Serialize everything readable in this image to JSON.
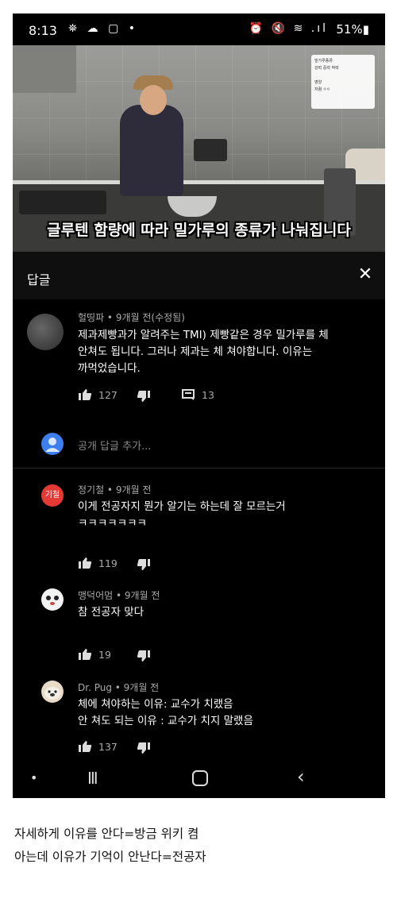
{
  "status_bar": {
    "time": "8:13",
    "left_icons": "⛯ ☁ ▢ •",
    "right_icons": "⏰ 🔇 ≋ .ıl",
    "battery": "51%"
  },
  "video": {
    "caption": "글루텐 함량에 따라 밀가루의 종류가 나눠집니다",
    "progress": 0.23,
    "overlay_lines": [
      "밀가루종류",
      "강력 중력 박력",
      "",
      "영양",
      "저렴 ㅇㅇ"
    ]
  },
  "panel": {
    "title": "답글",
    "close_label": "✕"
  },
  "main_comment": {
    "author": "헐띵파 • 9개월 전(수정됨)",
    "lines": [
      "제과제빵과가 알려주는 TMI) 제빵같은 경우 밀가루를 체",
      "안쳐도 됩니다. 그러나 제과는 체 쳐야합니다. 이유는",
      "까먹었습니다."
    ],
    "likes": "127",
    "replies": "13"
  },
  "add_reply": {
    "placeholder": "공개 답글 추가..."
  },
  "replies": [
    {
      "avatar_text": "기철",
      "author": "정기철 • 9개월 전",
      "lines": [
        "이게 전공자지 뭔가 알기는 하는데 잘 모르는거",
        "ㅋㅋㅋㅋㅋㅋㅋ"
      ],
      "likes": "119"
    },
    {
      "avatar_text": "",
      "author": "맹덕어멈 • 9개월 전",
      "lines": [
        "참 전공자 맞다"
      ],
      "likes": "19"
    },
    {
      "avatar_text": "",
      "author": "Dr. Pug • 9개월 전",
      "lines": [
        "체에 쳐야하는 이유: 교수가 치랬음",
        "안 쳐도 되는 이유 : 교수가 치지 말랬음"
      ],
      "likes": "137"
    }
  ],
  "nav": {
    "dot": "•",
    "recent": "III",
    "back": "‹"
  },
  "below_text": [
    "자세하게 이유를 안다=방금 위키 켬",
    "아는데 이유가 기억이 안난다=전공자"
  ],
  "colors": {
    "accent": "#ff0000",
    "panel_bg": "#000000",
    "reply_avatar_red": "#e53935",
    "add_reply_avatar": "#3e7ff0"
  }
}
